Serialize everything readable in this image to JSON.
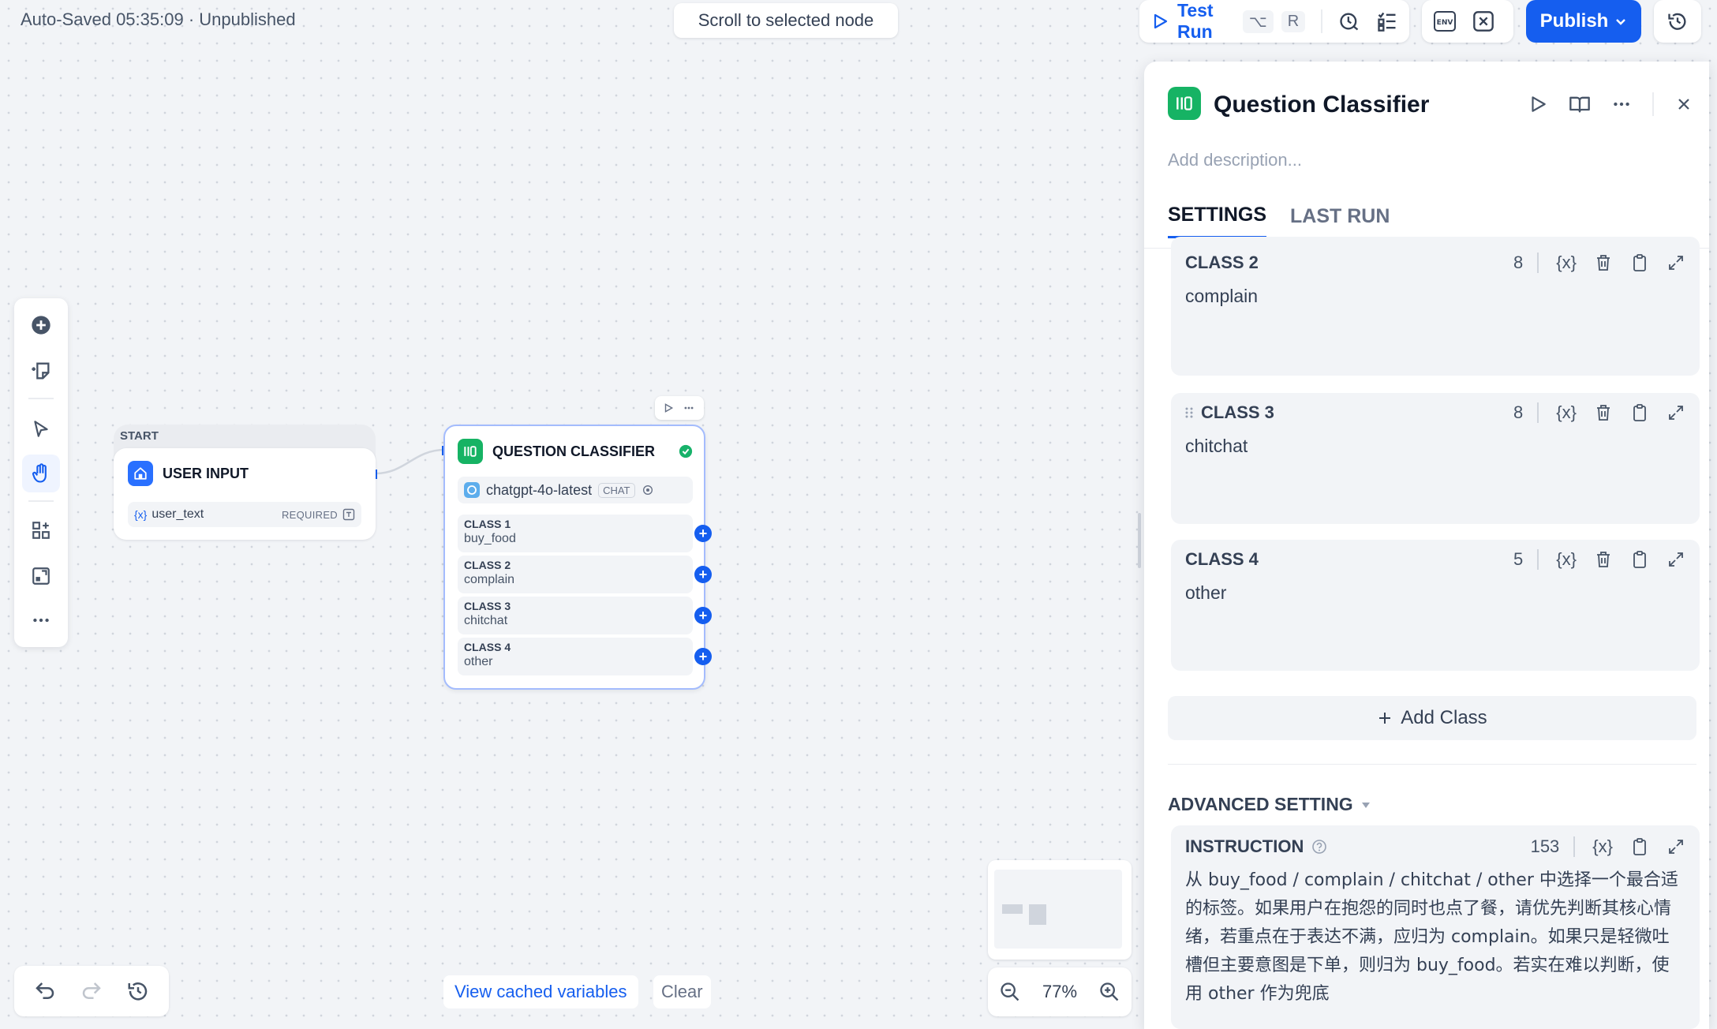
{
  "header": {
    "autosave_text": "Auto-Saved 05:35:09 · Unpublished",
    "scroll_button": "Scroll to selected node",
    "test_run_label": "Test Run",
    "test_run_shortcut_1": "⌥",
    "test_run_shortcut_2": "R",
    "env_label": "ENV",
    "publish_label": "Publish"
  },
  "canvas": {
    "start_node": {
      "tag": "START",
      "title": "USER INPUT",
      "variable_icon": "{x}",
      "variable_name": "user_text",
      "required_label": "REQUIRED"
    },
    "classifier_node": {
      "title": "QUESTION CLASSIFIER",
      "model": "chatgpt-4o-latest",
      "model_tag": "CHAT",
      "classes": [
        {
          "label": "CLASS 1",
          "value": "buy_food"
        },
        {
          "label": "CLASS 2",
          "value": "complain"
        },
        {
          "label": "CLASS 3",
          "value": "chitchat"
        },
        {
          "label": "CLASS 4",
          "value": "other"
        }
      ]
    }
  },
  "bottom": {
    "cached_variables": "View cached variables",
    "clear": "Clear",
    "zoom": "77%"
  },
  "panel": {
    "title": "Question Classifier",
    "description_placeholder": "Add description...",
    "tabs": [
      "SETTINGS",
      "LAST RUN"
    ],
    "var_icon": "{x}",
    "classes": [
      {
        "label": "CLASS 2",
        "count": "8",
        "text": "complain"
      },
      {
        "label": "CLASS 3",
        "count": "8",
        "text": "chitchat"
      },
      {
        "label": "CLASS 4",
        "count": "5",
        "text": "other"
      }
    ],
    "add_class": "Add Class",
    "advanced_setting": "ADVANCED SETTING",
    "instruction": {
      "label": "INSTRUCTION",
      "count": "153",
      "text": "从 buy_food / complain / chitchat / other 中选择一个最合适的标签。如果用户在抱怨的同时也点了餐，请优先判断其核心情绪，若重点在于表达不满，应归为 complain。如果只是轻微吐槽但主要意图是下单，则归为 buy_food。若实在难以判断，使用 other 作为兜底"
    }
  },
  "colors": {
    "accent": "#155eef",
    "classifier_green": "#16b364",
    "start_blue": "#2970ff"
  },
  "icons": [
    "play-icon",
    "history-icon",
    "checklist-icon",
    "env-icon",
    "variable-icon",
    "add-node-icon",
    "note-icon",
    "pointer-icon",
    "hand-icon",
    "organize-icon",
    "fit-icon",
    "more-icon",
    "undo-icon",
    "redo-icon",
    "zoom-out-icon",
    "zoom-in-icon",
    "book-icon",
    "close-icon",
    "trash-icon",
    "clipboard-icon",
    "expand-icon",
    "help-icon",
    "drag-icon"
  ]
}
